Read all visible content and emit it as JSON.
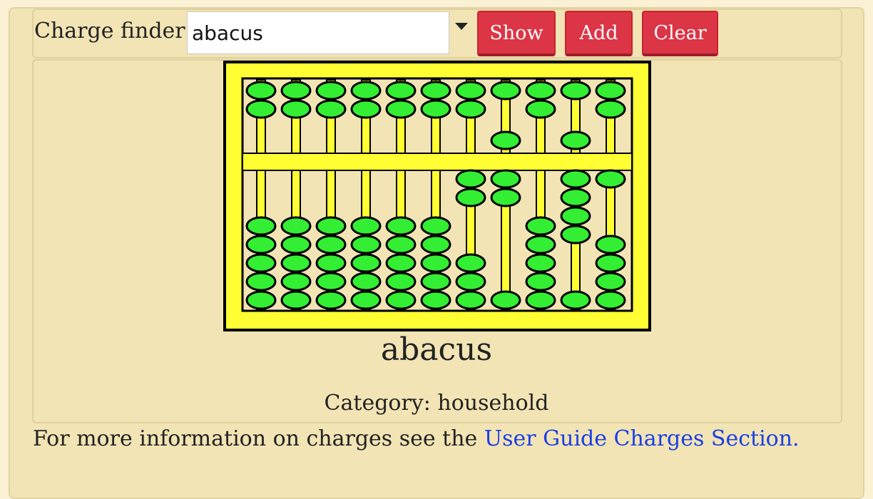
{
  "finder": {
    "label": "Charge finder:",
    "input_value": "abacus",
    "buttons": {
      "show": "Show",
      "add": "Add",
      "clear": "Clear"
    }
  },
  "charge": {
    "name": "abacus",
    "category_label": "Category:",
    "category_value": "household",
    "image_icon": "abacus-icon"
  },
  "info": {
    "text": "For more information on charges see the ",
    "link_text": "User Guide Charges Section."
  },
  "colors": {
    "button_red": "#dc3545",
    "panel_tan": "#f2e4b4",
    "abacus_frame_yellow": "#ffff33",
    "bead_green": "#33ee33",
    "link_blue": "#1a3ee8"
  }
}
